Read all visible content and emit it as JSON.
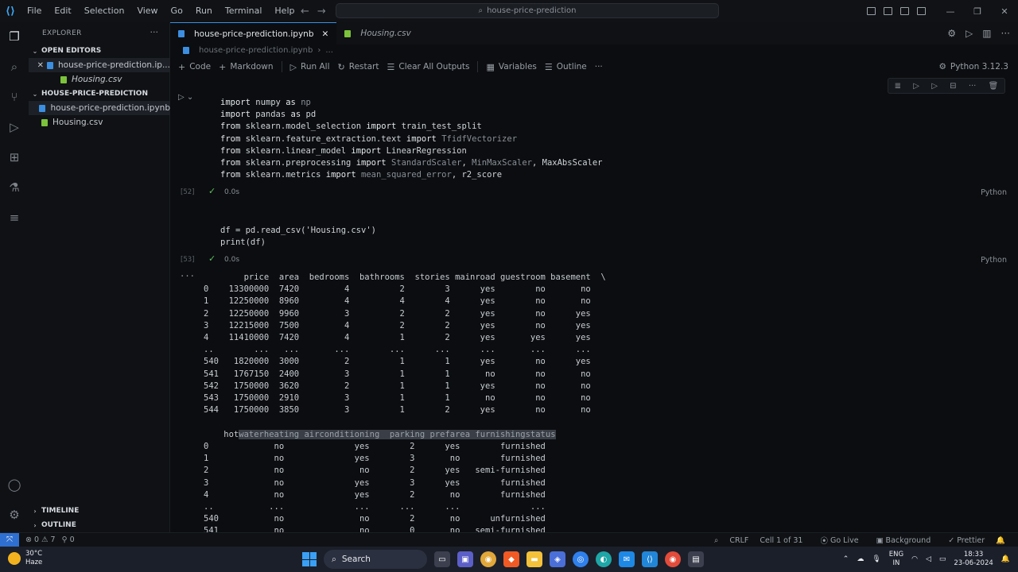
{
  "titlebar": {
    "menu": [
      "File",
      "Edit",
      "Selection",
      "View",
      "Go",
      "Run",
      "Terminal",
      "Help"
    ],
    "search_text": "house-price-prediction"
  },
  "sidebar": {
    "header": "EXPLORER",
    "open_editors_title": "OPEN EDITORS",
    "open_editors": [
      "house-price-prediction.ip...",
      "Housing.csv"
    ],
    "project_title": "HOUSE-PRICE-PREDICTION",
    "files": [
      "house-price-prediction.ipynb",
      "Housing.csv"
    ],
    "timeline_title": "TIMELINE",
    "outline_title": "OUTLINE"
  },
  "tabs": [
    {
      "label": "house-price-prediction.ipynb"
    },
    {
      "label": "Housing.csv"
    }
  ],
  "breadcrumb": [
    "house-price-prediction.ipynb",
    "..."
  ],
  "toolbar": {
    "code": "Code",
    "markdown": "Markdown",
    "run_all": "Run All",
    "restart": "Restart",
    "clear_outputs": "Clear All Outputs",
    "variables": "Variables",
    "outline": "Outline",
    "more": "···",
    "kernel": "Python 3.12.3"
  },
  "cells": [
    {
      "exec": "[52]",
      "duration": "0.0s",
      "lang": "Python"
    },
    {
      "exec": "[53]",
      "duration": "0.0s",
      "lang": "Python"
    }
  ],
  "output": {
    "more": "···",
    "table1": "        price  area  bedrooms  bathrooms  stories mainroad guestroom basement  \\\n0    13300000  7420         4          2        3      yes        no       no   \n1    12250000  8960         4          4        4      yes        no       no   \n2    12250000  9960         3          2        2      yes        no      yes   \n3    12215000  7500         4          2        2      yes        no      yes   \n4    11410000  7420         4          1        2      yes       yes      yes   \n..        ...   ...       ...        ...      ...      ...       ...      ...   \n540   1820000  3000         2          1        1      yes        no      yes   \n541   1767150  2400         3          1        1       no        no       no   \n542   1750000  3620         2          1        1      yes        no       no   \n543   1750000  2910         3          1        1       no        no       no   \n544   1750000  3850         3          1        2      yes        no       no",
    "table2_prefix": "    hot",
    "table2_selected": "waterheating airconditioning  parking prefarea furnishingstatus",
    "table2": "0             no              yes        2      yes        furnished  \n1             no              yes        3       no        furnished  \n2             no               no        2      yes   semi-furnished  \n3             no              yes        3      yes        furnished  \n4             no              yes        2       no        furnished  \n..           ...              ...      ...      ...              ...  \n540           no               no        2       no      unfurnished  \n541           no               no        0       no   semi-furnished"
  },
  "statusbar": {
    "errors": "0",
    "warnings": "7",
    "ports": "0",
    "eol": "CRLF",
    "cell": "Cell 1 of 31",
    "go_live": "Go Live",
    "background": "Background",
    "prettier": "Prettier"
  },
  "taskbar": {
    "temp": "30°C",
    "weather": "Haze",
    "search": "Search",
    "lang_top": "ENG",
    "lang_bottom": "IN",
    "time": "18:33",
    "date": "23-06-2024"
  }
}
